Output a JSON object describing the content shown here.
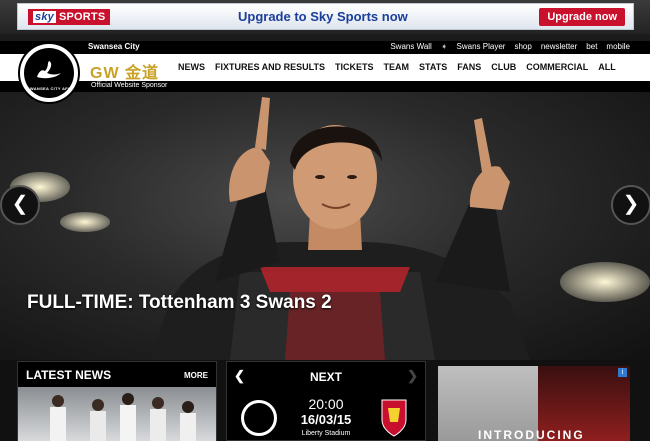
{
  "top_ad": {
    "brand_sky": "sky",
    "brand_sports": "SPORTS",
    "headline": "Upgrade to Sky Sports now",
    "cta": "Upgrade now"
  },
  "header": {
    "club_name": "Swansea City",
    "crest_text": "SWANSEA CITY AFC",
    "sponsor_logo": "GW 金道",
    "sponsor_label": "Official Website Sponsor",
    "util_links": [
      "Swans Wall",
      "Swans Player",
      "shop",
      "newsletter",
      "bet",
      "mobile"
    ],
    "nav": [
      "NEWS",
      "FIXTURES AND RESULTS",
      "TICKETS",
      "TEAM",
      "STATS",
      "FANS",
      "CLUB",
      "COMMERCIAL",
      "ALL"
    ]
  },
  "hero": {
    "caption": "FULL-TIME: Tottenham 3 Swans 2",
    "prev_glyph": "❮",
    "next_glyph": "❯"
  },
  "latest_news": {
    "title": "LATEST NEWS",
    "more": "MORE"
  },
  "next_fixture": {
    "title": "NEXT",
    "time": "20:00",
    "date": "16/03/15",
    "venue": "Liberty Stadium",
    "prev_glyph": "❮",
    "next_glyph": "❯"
  },
  "side_ad": {
    "text": "INTRODUCING",
    "info_glyph": "i"
  },
  "colors": {
    "sky_red": "#c9102c",
    "sky_blue": "#1b3e9b",
    "sponsor_gold": "#c9a227"
  }
}
